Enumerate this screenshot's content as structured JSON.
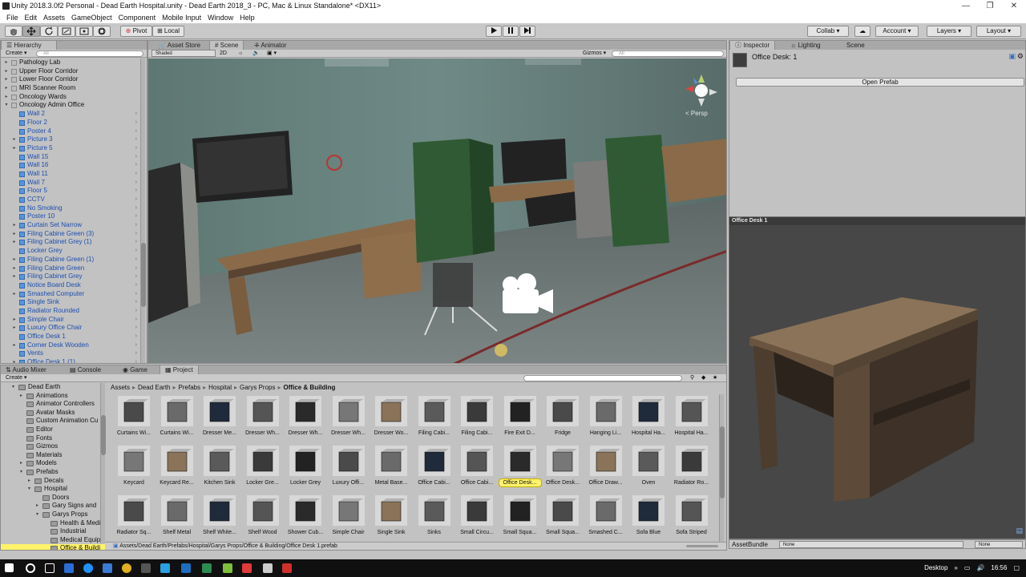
{
  "window": {
    "title": "Unity 2018.3.0f2 Personal - Dead Earth Hospital.unity - Dead Earth 2018_3 - PC, Mac & Linux Standalone* <DX11>",
    "controls": [
      "—",
      "❐",
      "✕"
    ]
  },
  "menu": [
    "File",
    "Edit",
    "Assets",
    "GameObject",
    "Component",
    "Mobile Input",
    "Window",
    "Help"
  ],
  "toolbar": {
    "pivot": "Pivot",
    "local": "Local",
    "collab": "Collab",
    "account": "Account",
    "layers": "Layers",
    "layout": "Layout"
  },
  "hierarchy": {
    "tab": "Hierarchy",
    "create": "Create",
    "search_placeholder": "All",
    "rows": [
      {
        "label": "Pathology Lab",
        "depth": 0,
        "blue": false,
        "arrow": "▸"
      },
      {
        "label": "Upper Floor Corridor",
        "depth": 0,
        "blue": false,
        "arrow": "▸"
      },
      {
        "label": "Lower Floor Corridor",
        "depth": 0,
        "blue": false,
        "arrow": "▸"
      },
      {
        "label": "MRI Scanner Room",
        "depth": 0,
        "blue": false,
        "arrow": "▸"
      },
      {
        "label": "Oncology Wards",
        "depth": 0,
        "blue": false,
        "arrow": "▸"
      },
      {
        "label": "Oncology Admin Office",
        "depth": 0,
        "blue": false,
        "arrow": "▾"
      },
      {
        "label": "Wall 2",
        "depth": 1,
        "blue": true,
        "arrow": ""
      },
      {
        "label": "Floor 2",
        "depth": 1,
        "blue": true,
        "arrow": ""
      },
      {
        "label": "Poster 4",
        "depth": 1,
        "blue": true,
        "arrow": ""
      },
      {
        "label": "Picture 3",
        "depth": 1,
        "blue": true,
        "arrow": "▸"
      },
      {
        "label": "Picture 5",
        "depth": 1,
        "blue": true,
        "arrow": "▸"
      },
      {
        "label": "Wall 15",
        "depth": 1,
        "blue": true,
        "arrow": ""
      },
      {
        "label": "Wall 16",
        "depth": 1,
        "blue": true,
        "arrow": ""
      },
      {
        "label": "Wall 11",
        "depth": 1,
        "blue": true,
        "arrow": ""
      },
      {
        "label": "Wall 7",
        "depth": 1,
        "blue": true,
        "arrow": ""
      },
      {
        "label": "Floor 5",
        "depth": 1,
        "blue": true,
        "arrow": ""
      },
      {
        "label": "CCTV",
        "depth": 1,
        "blue": true,
        "arrow": ""
      },
      {
        "label": "No Smoking",
        "depth": 1,
        "blue": true,
        "arrow": ""
      },
      {
        "label": "Poster 10",
        "depth": 1,
        "blue": true,
        "arrow": ""
      },
      {
        "label": "Curtain Set Narrow",
        "depth": 1,
        "blue": true,
        "arrow": "▸"
      },
      {
        "label": "Filing Cabine Green (3)",
        "depth": 1,
        "blue": true,
        "arrow": "▸"
      },
      {
        "label": "Filing Cabinet Grey (1)",
        "depth": 1,
        "blue": true,
        "arrow": "▸"
      },
      {
        "label": "Locker Grey",
        "depth": 1,
        "blue": true,
        "arrow": ""
      },
      {
        "label": "Filing Cabine Green (1)",
        "depth": 1,
        "blue": true,
        "arrow": "▸"
      },
      {
        "label": "Filing Cabine Green",
        "depth": 1,
        "blue": true,
        "arrow": "▸"
      },
      {
        "label": "Filing Cabinet Grey",
        "depth": 1,
        "blue": true,
        "arrow": "▸"
      },
      {
        "label": "Notice Board Desk",
        "depth": 1,
        "blue": true,
        "arrow": ""
      },
      {
        "label": "Smashed Computer",
        "depth": 1,
        "blue": true,
        "arrow": "▸"
      },
      {
        "label": "Single Sink",
        "depth": 1,
        "blue": true,
        "arrow": ""
      },
      {
        "label": "Radiator Rounded",
        "depth": 1,
        "blue": true,
        "arrow": ""
      },
      {
        "label": "Simple Chair",
        "depth": 1,
        "blue": true,
        "arrow": "▸"
      },
      {
        "label": "Luxury Office Chair",
        "depth": 1,
        "blue": true,
        "arrow": "▸"
      },
      {
        "label": "Office Desk 1",
        "depth": 1,
        "blue": true,
        "arrow": ""
      },
      {
        "label": "Corner Desk Wooden",
        "depth": 1,
        "blue": true,
        "arrow": "▸"
      },
      {
        "label": "Vents",
        "depth": 1,
        "blue": true,
        "arrow": ""
      },
      {
        "label": "Office Desk 1 (1)",
        "depth": 1,
        "blue": true,
        "arrow": "▸"
      }
    ]
  },
  "scene": {
    "tabs": [
      "Asset Store",
      "Scene",
      "Animator"
    ],
    "active_tab": "Scene",
    "shading": "Shaded",
    "mode_2d": "2D",
    "gizmos": "Gizmos",
    "search_placeholder": "All",
    "persp": "< Persp"
  },
  "bottom_tabs": {
    "tabs": [
      "Audio Mixer",
      "Console",
      "Game",
      "Project"
    ],
    "active": "Project",
    "create": "Create"
  },
  "project": {
    "tree": [
      {
        "label": "Dead Earth",
        "depth": 0,
        "arrow": "▾"
      },
      {
        "label": "Animations",
        "depth": 1,
        "arrow": "▸"
      },
      {
        "label": "Animator Controllers",
        "depth": 1,
        "arrow": ""
      },
      {
        "label": "Avatar Masks",
        "depth": 1,
        "arrow": ""
      },
      {
        "label": "Custom Animation Cu",
        "depth": 1,
        "arrow": ""
      },
      {
        "label": "Editor",
        "depth": 1,
        "arrow": ""
      },
      {
        "label": "Fonts",
        "depth": 1,
        "arrow": ""
      },
      {
        "label": "Gizmos",
        "depth": 1,
        "arrow": ""
      },
      {
        "label": "Materials",
        "depth": 1,
        "arrow": ""
      },
      {
        "label": "Models",
        "depth": 1,
        "arrow": "▸"
      },
      {
        "label": "Prefabs",
        "depth": 1,
        "arrow": "▾"
      },
      {
        "label": "Decals",
        "depth": 2,
        "arrow": "▸"
      },
      {
        "label": "Hospital",
        "depth": 2,
        "arrow": "▾"
      },
      {
        "label": "Doors",
        "depth": 3,
        "arrow": ""
      },
      {
        "label": "Gary Signs and",
        "depth": 3,
        "arrow": "▸"
      },
      {
        "label": "Garys Props",
        "depth": 3,
        "arrow": "▾"
      },
      {
        "label": "Health & Medic",
        "depth": 4,
        "arrow": ""
      },
      {
        "label": "Industrial",
        "depth": 4,
        "arrow": ""
      },
      {
        "label": "Medical Equipt",
        "depth": 4,
        "arrow": ""
      },
      {
        "label": "Office & Buildi",
        "depth": 4,
        "arrow": "",
        "selected": true
      }
    ],
    "breadcrumb": [
      "Assets",
      "Dead Earth",
      "Prefabs",
      "Hospital",
      "Garys Props",
      "Office & Building"
    ],
    "breadcrumb_sep": "▸",
    "assets": [
      [
        "Curtains Wi...",
        "Curtains Wi...",
        "Dresser Me...",
        "Dresser Wh...",
        "Dresser Wh...",
        "Dresser Wh...",
        "Dresser Wo...",
        "Filing Cabi...",
        "Filing Cabi...",
        "Fire Exit D...",
        "Fridge",
        "Hanging Li...",
        "Hospital Ha...",
        "Hospital Ha..."
      ],
      [
        "Keycard",
        "Keycard Re...",
        "Kitchen Sink",
        "Locker Gre...",
        "Locker Grey",
        "Luxury Offi...",
        "Metal Base...",
        "Office Cabi...",
        "Office Cabi...",
        "Office Desk...",
        "Office Desk...",
        "Office Draw...",
        "Oven",
        "Radiator Ro..."
      ],
      [
        "Radiator Sq...",
        "Shelf Metal",
        "Shelf White...",
        "Shelf Wood",
        "Shower Cub...",
        "Simple Chair",
        "Single Sink",
        "Sinks",
        "Small Circu...",
        "Small Squa...",
        "Small Squa...",
        "Smashed C...",
        "Sofa Blue",
        "Sofa Striped"
      ]
    ],
    "selected_asset": "Office Desk...",
    "path": "Assets/Dead Earth/Prefabs/Hospital/Garys Props/Office & Building/Office Desk 1.prefab"
  },
  "inspector": {
    "tabs": [
      "Inspector",
      "Lighting",
      "Scene"
    ],
    "active": "Inspector",
    "object_name": "Office Desk: 1",
    "open_prefab": "Open Prefab"
  },
  "preview": {
    "title": "Office Desk 1"
  },
  "assetbundle": {
    "label": "AssetBundle",
    "value1": "None",
    "value2": "None"
  },
  "taskbar": {
    "desktop": "Desktop",
    "time": "16:56"
  },
  "colors": {
    "selection": "#fff36a",
    "prefab_blue": "#1d4fb0",
    "panel_bg": "#c2c2c2",
    "taskbar": "#101010"
  }
}
